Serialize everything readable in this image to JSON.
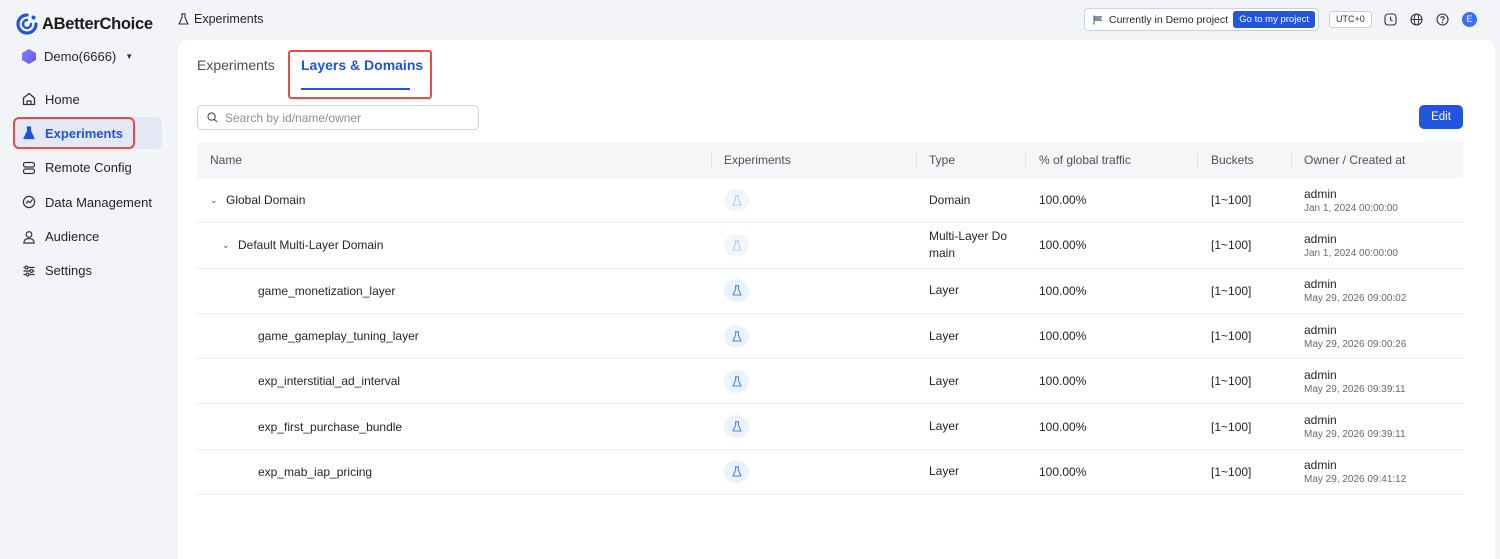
{
  "brand": {
    "name": "ABetterChoice",
    "accent": "#2153d8"
  },
  "project": {
    "label": "Demo(6666)"
  },
  "sidebar": {
    "items": [
      {
        "label": "Home",
        "icon": "home-icon"
      },
      {
        "label": "Experiments",
        "icon": "flask-icon",
        "active": true
      },
      {
        "label": "Remote Config",
        "icon": "server-icon"
      },
      {
        "label": "Data Management",
        "icon": "data-icon"
      },
      {
        "label": "Audience",
        "icon": "user-icon"
      },
      {
        "label": "Settings",
        "icon": "sliders-icon"
      }
    ]
  },
  "header": {
    "breadcrumb": "Experiments",
    "demo_notice": "Currently in Demo project",
    "demo_button": "Go to my project",
    "timezone": "UTC+0",
    "avatar_initial": "E"
  },
  "tabs": [
    {
      "label": "Experiments"
    },
    {
      "label": "Layers & Domains",
      "active": true
    }
  ],
  "search": {
    "placeholder": "Search by id/name/owner",
    "value": ""
  },
  "edit_label": "Edit",
  "table": {
    "columns": [
      "Name",
      "Experiments",
      "Type",
      "% of global traffic",
      "Buckets",
      "Owner / Created at"
    ],
    "rows": [
      {
        "name": "Global Domain",
        "type": "Domain",
        "traffic": "100.00%",
        "buckets": "[1~100]",
        "owner": "admin",
        "created": "Jan 1, 2024 00:00:00",
        "level": 0,
        "expandable": true
      },
      {
        "name": "Default Multi-Layer Domain",
        "type": "Multi-Layer Do main",
        "traffic": "100.00%",
        "buckets": "[1~100]",
        "owner": "admin",
        "created": "Jan 1, 2024 00:00:00",
        "level": 1,
        "expandable": true
      },
      {
        "name": "game_monetization_layer",
        "type": "Layer",
        "traffic": "100.00%",
        "buckets": "[1~100]",
        "owner": "admin",
        "created": "May 29, 2026 09:00:02",
        "level": 2,
        "expandable": false
      },
      {
        "name": "game_gameplay_tuning_layer",
        "type": "Layer",
        "traffic": "100.00%",
        "buckets": "[1~100]",
        "owner": "admin",
        "created": "May 29, 2026 09:00:26",
        "level": 2,
        "expandable": false
      },
      {
        "name": "exp_interstitial_ad_interval",
        "type": "Layer",
        "traffic": "100.00%",
        "buckets": "[1~100]",
        "owner": "admin",
        "created": "May 29, 2026 09:39:11",
        "level": 2,
        "expandable": false
      },
      {
        "name": "exp_first_purchase_bundle",
        "type": "Layer",
        "traffic": "100.00%",
        "buckets": "[1~100]",
        "owner": "admin",
        "created": "May 29, 2026 09:39:11",
        "level": 2,
        "expandable": false
      },
      {
        "name": "exp_mab_iap_pricing",
        "type": "Layer",
        "traffic": "100.00%",
        "buckets": "[1~100]",
        "owner": "admin",
        "created": "May 29, 2026 09:41:12",
        "level": 2,
        "expandable": false
      }
    ]
  }
}
